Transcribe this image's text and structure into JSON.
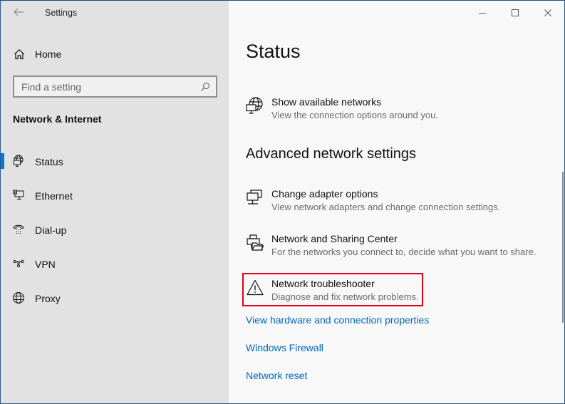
{
  "window": {
    "title": "Settings",
    "controls": {
      "minimize": "minimize-icon",
      "maximize": "maximize-icon",
      "close": "close-icon"
    }
  },
  "sidebar": {
    "back_icon": "arrow-left-icon",
    "home": {
      "label": "Home",
      "icon": "home-icon"
    },
    "search": {
      "placeholder": "Find a setting",
      "value": "",
      "icon": "search-icon"
    },
    "section_title": "Network & Internet",
    "items": [
      {
        "label": "Status",
        "icon": "globe-monitor-icon",
        "active": true
      },
      {
        "label": "Ethernet",
        "icon": "ethernet-icon",
        "active": false
      },
      {
        "label": "Dial-up",
        "icon": "dialup-phone-icon",
        "active": false
      },
      {
        "label": "VPN",
        "icon": "vpn-icon",
        "active": false
      },
      {
        "label": "Proxy",
        "icon": "globe-icon",
        "active": false
      }
    ],
    "accent_color": "#0078d7"
  },
  "main": {
    "title": "Status",
    "show_networks": {
      "title": "Show available networks",
      "description": "View the connection options around you.",
      "icon": "globe-monitor-icon"
    },
    "advanced_title": "Advanced network settings",
    "advanced_items": [
      {
        "title": "Change adapter options",
        "description": "View network adapters and change connection settings.",
        "icon": "adapter-monitors-icon"
      },
      {
        "title": "Network and Sharing Center",
        "description": "For the networks you connect to, decide what you want to share.",
        "icon": "sharing-center-icon"
      },
      {
        "title": "Network troubleshooter",
        "description": "Diagnose and fix network problems.",
        "icon": "warning-icon",
        "highlighted": true
      }
    ],
    "links": [
      "View hardware and connection properties",
      "Windows Firewall",
      "Network reset"
    ],
    "link_color": "#0067b8",
    "highlight_color": "#e0001a"
  }
}
